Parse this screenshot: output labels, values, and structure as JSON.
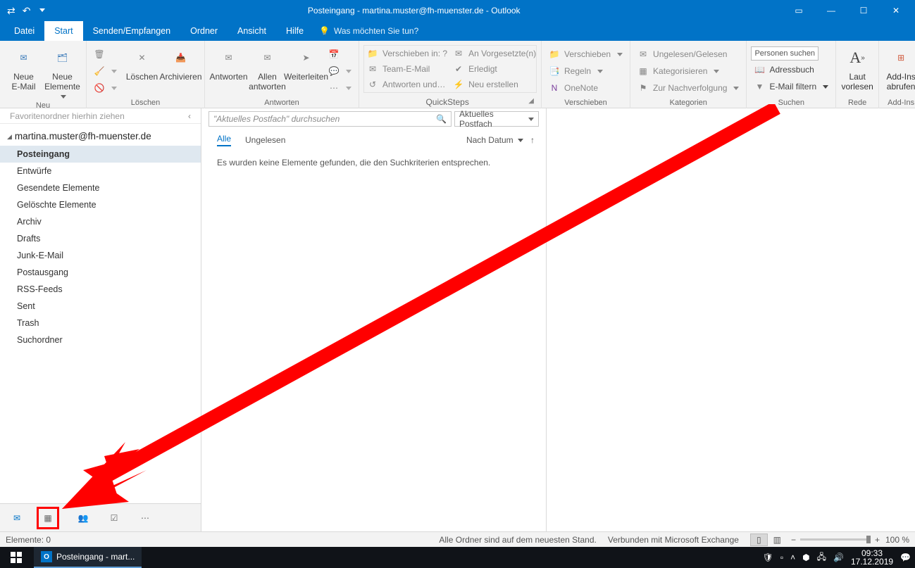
{
  "title": "Posteingang - martina.muster@fh-muenster.de - Outlook",
  "tabs": {
    "file": "Datei",
    "start": "Start",
    "sendreceive": "Senden/Empfangen",
    "folder": "Ordner",
    "view": "Ansicht",
    "help": "Hilfe",
    "tellme": "Was möchten Sie tun?"
  },
  "ribbon": {
    "new": {
      "mail": "Neue\nE-Mail",
      "items": "Neue\nElemente",
      "label": "Neu"
    },
    "delete": {
      "delete": "Löschen",
      "archive": "Archivieren",
      "label": "Löschen"
    },
    "respond": {
      "reply": "Antworten",
      "replyall": "Allen\nantworten",
      "forward": "Weiterleiten",
      "label": "Antworten"
    },
    "quicksteps": {
      "moveTo": "Verschieben in: ?",
      "toManager": "An Vorgesetzte(n)",
      "teamEmail": "Team-E-Mail",
      "done": "Erledigt",
      "replyDelete": "Antworten und…",
      "createNew": "Neu erstellen",
      "label": "QuickSteps"
    },
    "move": {
      "move": "Verschieben",
      "rules": "Regeln",
      "onenote": "OneNote",
      "label": "Verschieben"
    },
    "tags": {
      "unread": "Ungelesen/Gelesen",
      "categorize": "Kategorisieren",
      "followup": "Zur Nachverfolgung",
      "label": "Kategorien"
    },
    "find": {
      "searchPeople": "Personen suchen",
      "addressbook": "Adressbuch",
      "filter": "E-Mail filtern",
      "label": "Suchen"
    },
    "speech": {
      "readaloud": "Laut\nvorlesen",
      "label": "Rede"
    },
    "addins": {
      "addins": "Add-Ins\nabrufen",
      "label": "Add-Ins"
    }
  },
  "favhint": "Favoritenordner hierhin ziehen",
  "account": "martina.muster@fh-muenster.de",
  "folders": [
    "Posteingang",
    "Entwürfe",
    "Gesendete Elemente",
    "Gelöschte Elemente",
    "Archiv",
    "Drafts",
    "Junk-E-Mail",
    "Postausgang",
    "RSS-Feeds",
    "Sent",
    "Trash",
    "Suchordner"
  ],
  "search": {
    "placeholder": "\"Aktuelles Postfach\" durchsuchen",
    "scope": "Aktuelles Postfach"
  },
  "filters": {
    "all": "Alle",
    "unread": "Ungelesen",
    "sort": "Nach Datum"
  },
  "emptyMessage": "Es wurden keine Elemente gefunden, die den Suchkriterien entsprechen.",
  "status": {
    "items": "Elemente: 0",
    "sync": "Alle Ordner sind auf dem neuesten Stand.",
    "conn": "Verbunden mit Microsoft Exchange",
    "zoom": "100 %"
  },
  "taskbar": {
    "app": "Posteingang - mart...",
    "time": "09:33",
    "date": "17.12.2019"
  }
}
